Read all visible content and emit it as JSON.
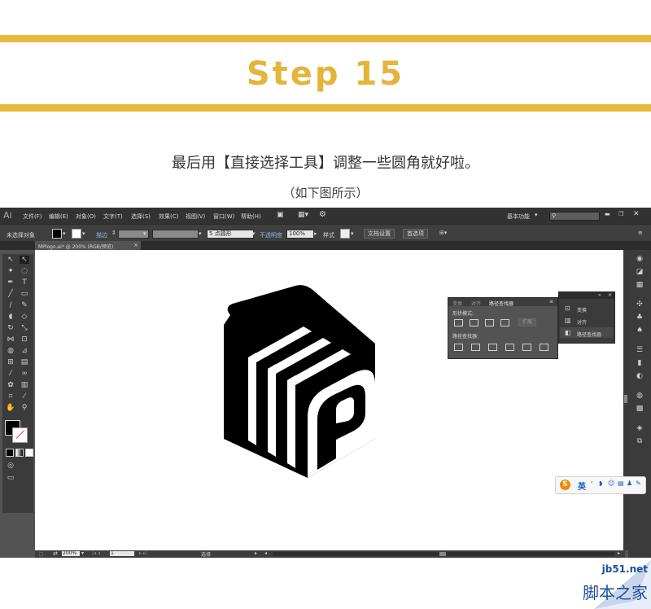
{
  "heading": {
    "title": "Step 15"
  },
  "instructions": {
    "line1": "最后用【直接选择工具】调整一些圆角就好啦。",
    "line2": "（如下图所示）"
  },
  "app": {
    "logo": "Ai",
    "menu": [
      "文件(F)",
      "编辑(E)",
      "对象(O)",
      "文字(T)",
      "选择(S)",
      "效果(C)",
      "视图(V)",
      "窗口(W)",
      "帮助(H)"
    ],
    "workspace": "基本功能",
    "control_bar": {
      "selection": "未选择对象",
      "stroke_label": "描边",
      "brush": "5 点圆形",
      "opacity_label": "不透明度",
      "opacity_value": "100%",
      "style_label": "样式",
      "doc_settings": "文档设置",
      "preferences": "首选项"
    },
    "document_tab": "MPlogo.ai* @ 200% (RGB/预览)",
    "status": {
      "zoom": "200%",
      "page": "1",
      "tool": "选择"
    },
    "pathfinder_panel": {
      "tabs": [
        "变换",
        "对齐",
        "路径查找器"
      ],
      "shape_modes_label": "形状模式:",
      "expand_button": "扩展",
      "pathfinders_label": "路径查找器:"
    },
    "panel_list": {
      "items": [
        "变换",
        "对齐",
        "路径查找器"
      ]
    },
    "ime": {
      "label": "英"
    }
  },
  "watermark": {
    "site": "jb51.net",
    "name": "脚本之家"
  },
  "colors": {
    "accent": "#e9b93f",
    "chrome": "#535353",
    "menubar": "#323232"
  }
}
